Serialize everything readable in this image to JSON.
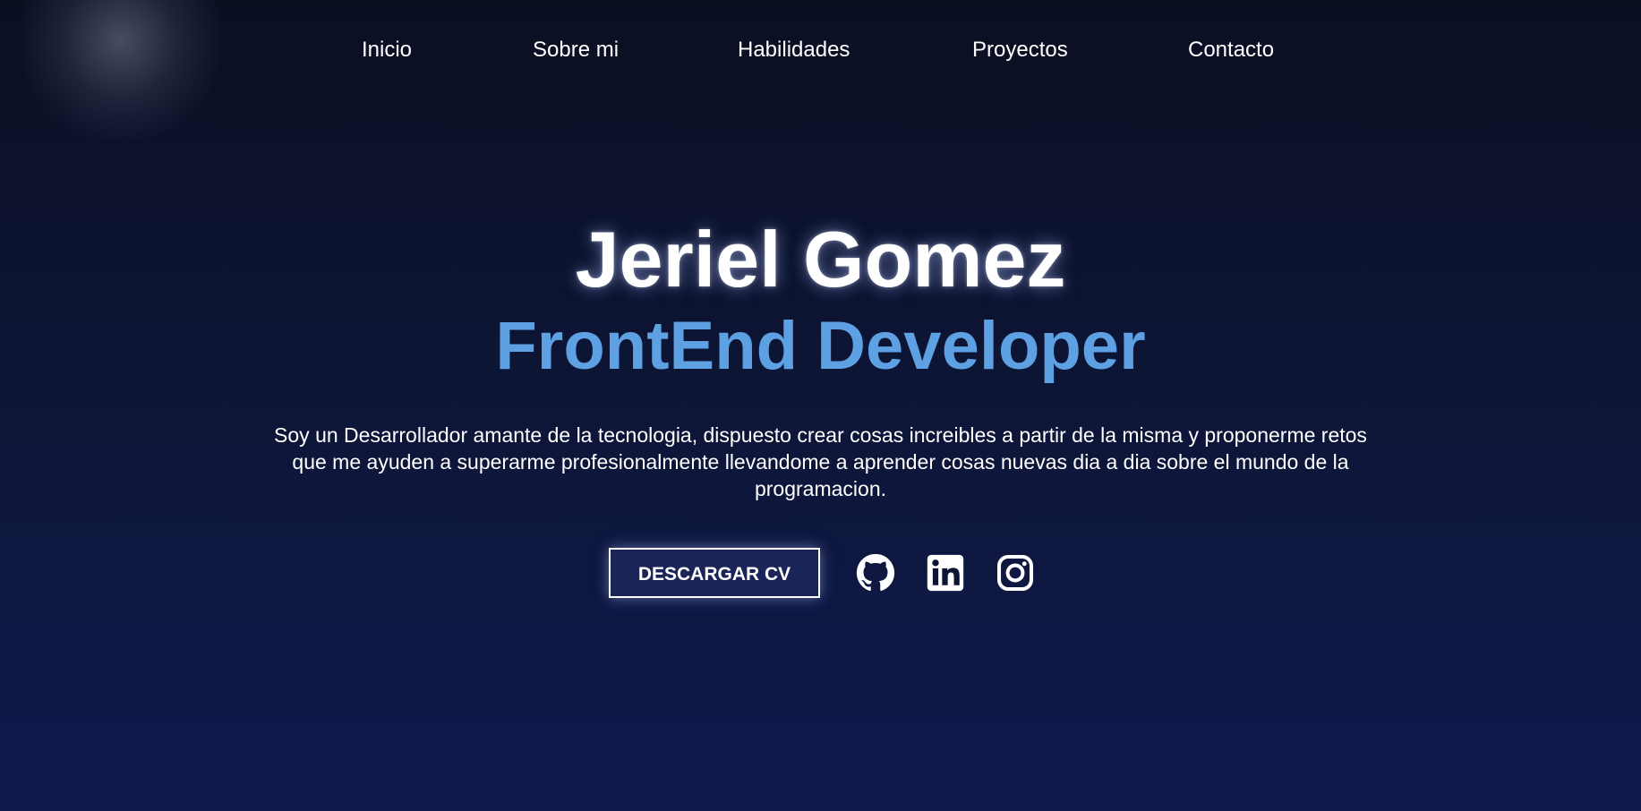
{
  "nav": {
    "items": [
      {
        "label": "Inicio"
      },
      {
        "label": "Sobre mi"
      },
      {
        "label": "Habilidades"
      },
      {
        "label": "Proyectos"
      },
      {
        "label": "Contacto"
      }
    ]
  },
  "hero": {
    "name": "Jeriel Gomez",
    "role": "FrontEnd Developer",
    "bio": "Soy un Desarrollador amante de la tecnologia, dispuesto crear cosas increibles a partir de la misma y proponerme retos que me ayuden a superarme profesionalmente llevandome a aprender cosas nuevas dia a dia sobre el mundo de la programacion.",
    "cv_button": "DESCARGAR CV"
  },
  "social": {
    "icons": [
      "github-icon",
      "linkedin-icon",
      "instagram-icon"
    ]
  },
  "colors": {
    "background_top": "#0b0f22",
    "background_bottom": "#0f1a4e",
    "accent": "#5ea1e3",
    "button_fill": "#1b2458"
  }
}
